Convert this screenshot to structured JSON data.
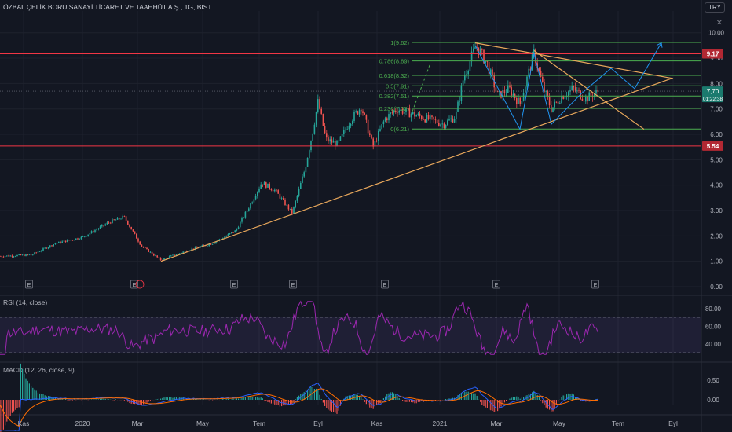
{
  "header": {
    "title": "ÖZBAL ÇELİK BORU SANAYİ TİCARET VE TAAHHÜT A.Ş., 1G, BIST",
    "currency": "TRY",
    "close_icon": "close-icon"
  },
  "colors": {
    "background": "#131722",
    "up": "#26a69a",
    "down": "#ef5350",
    "trend": "#e8a75b",
    "fib": "#4caf50",
    "projection": "#2196f3",
    "rsi": "#9c27b0",
    "macd": "#2962ff",
    "signal": "#ff6d00",
    "hline": "#f23645"
  },
  "price_axis": {
    "ticks": [
      "10.00",
      "9.00",
      "8.00",
      "7.00",
      "6.00",
      "5.00",
      "4.00",
      "3.00",
      "2.00",
      "1.00",
      "0.00"
    ]
  },
  "price_labels": {
    "upper_line": "9.17",
    "current": "7,70",
    "countdown": "01:22:38",
    "lower_line": "5.54"
  },
  "fib_levels": [
    "1(9.62)",
    "0.786(8.89)",
    "0.618(8.32)",
    "0.5(7.91)",
    "0.382(7.51)",
    "0.236(7.02)",
    "0(6.21)"
  ],
  "earnings_marker": "E",
  "rsi": {
    "label": "RSI (14, close)",
    "ticks": [
      "80.00",
      "60.00",
      "40.00"
    ]
  },
  "macd": {
    "label": "MACD (12, 26, close, 9)",
    "ticks": [
      "0.50",
      "0.00"
    ]
  },
  "time_axis": [
    "Kas",
    "2020",
    "Mar",
    "May",
    "Tem",
    "Eyl",
    "Kas",
    "2021",
    "Mar",
    "May",
    "Tem",
    "Eyl"
  ],
  "chart_data": {
    "type": "candlestick",
    "title": "ÖZBAL ÇELİK BORU SANAYİ TİCARET VE TAAHHÜT A.Ş., 1G, BIST",
    "yrange": [
      0,
      10.7
    ],
    "series_close_keypoints": [
      {
        "x": "Kas",
        "y": 1.2
      },
      {
        "x": "2020",
        "y": 1.95
      },
      {
        "x": "Şub",
        "y": 2.5
      },
      {
        "x": "Mar",
        "y": 1.1
      },
      {
        "x": "May",
        "y": 1.7
      },
      {
        "x": "Haz",
        "y": 2.6
      },
      {
        "x": "Tem",
        "y": 4.0
      },
      {
        "x": "Ağu",
        "y": 3.0
      },
      {
        "x": "Eyl",
        "y": 6.3
      },
      {
        "x": "Eki",
        "y": 6.6
      },
      {
        "x": "Kas",
        "y": 6.8
      },
      {
        "x": "2021",
        "y": 6.3
      },
      {
        "x": "Şub",
        "y": 9.5
      },
      {
        "x": "Mar",
        "y": 6.4
      },
      {
        "x": "Nis",
        "y": 9.2
      },
      {
        "x": "May",
        "y": 7.5
      },
      {
        "x": "Haz",
        "y": 7.7
      }
    ],
    "horizontal_lines": [
      9.17,
      5.54
    ],
    "last_price": 7.7
  }
}
